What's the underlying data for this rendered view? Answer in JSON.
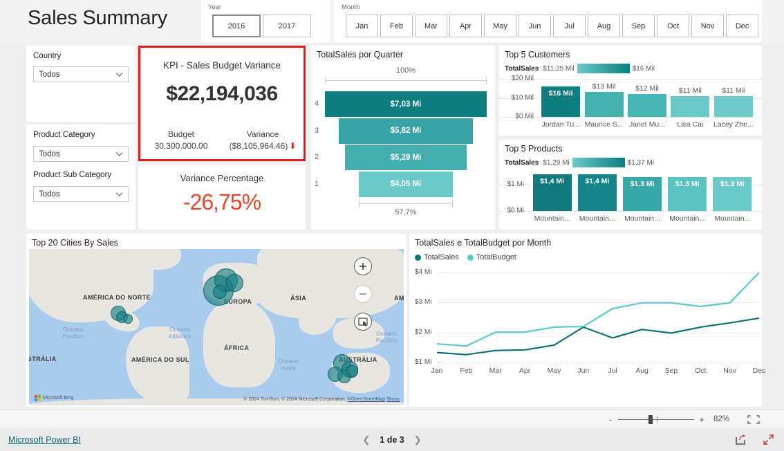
{
  "report": {
    "title": "Sales Summary"
  },
  "year_slicer": {
    "label": "Year",
    "options": [
      "2016",
      "2017"
    ],
    "selected": "2016"
  },
  "month_slicer": {
    "label": "Month",
    "options": [
      "Jan",
      "Feb",
      "Mar",
      "Apr",
      "May",
      "Jun",
      "Jul",
      "Aug",
      "Sep",
      "Oct",
      "Nov",
      "Dec"
    ]
  },
  "filters": [
    {
      "label": "Country",
      "value": "Todos",
      "icon": "chevron-down-icon"
    },
    {
      "label": "Product Category",
      "value": "Todos",
      "icon": "chevron-down-icon"
    },
    {
      "label": "Product Sub Category",
      "value": "Todos",
      "icon": "chevron-down-icon"
    }
  ],
  "kpi": {
    "title": "KPI - Sales Budget Variance",
    "value": "$22,194,036",
    "budget_caption": "Budget",
    "budget_value": "30,300,000.00",
    "variance_caption": "Variance",
    "variance_value": "($8,105,964.46)",
    "trend_icon": "down-arrow-icon",
    "border_color": "#e01b1b"
  },
  "variance_percentage": {
    "title": "Variance Percentage",
    "value": "-26,75%",
    "color": "#e8472a"
  },
  "map": {
    "title": "Top 20 Cities By Sales",
    "attribution": "© 2024 TomTom, © 2024 Microsoft Corporation,",
    "attribution_osm": "©OpenStreetMap",
    "attribution_terms": "Terms",
    "provider": "Microsoft Bing",
    "continents": [
      "AMÉRICA DO NORTE",
      "EUROPA",
      "ÁSIA",
      "ÁFRICA",
      "AMÉRICA DO SUL",
      "AUSTRÁLIA",
      "AUSTRÁLIA",
      "AM"
    ],
    "oceans": [
      "Oceano Pacífico",
      "Oceano Atlântico",
      "Oceano Pacífico",
      "Oceano Índico"
    ],
    "controls": [
      "zoom-in-icon",
      "zoom-out-icon",
      "select-tool-icon"
    ]
  },
  "statusbar": {
    "zoom_out_label": "-",
    "zoom_in_label": "+",
    "zoom_value": "82%",
    "fit_icon": "fit-to-page-icon"
  },
  "footer": {
    "brand": "Microsoft Power BI",
    "page_text": "1 de 3",
    "prev_icon": "chevron-left-icon",
    "next_icon": "chevron-right-icon",
    "share_icon": "share-icon",
    "fullscreen_icon": "fullscreen-icon"
  },
  "chart_data": [
    {
      "id": "funnel",
      "type": "bar",
      "title": "TotalSales por Quarter",
      "categories": [
        "4",
        "3",
        "2",
        "1"
      ],
      "values": [
        7.03,
        5.82,
        5.29,
        4.05
      ],
      "labels": [
        "$7,03 Mi",
        "$5,82 Mi",
        "$5,29 Mi",
        "$4,05 Mi"
      ],
      "top_measure": "100%",
      "bottom_measure": "57,7%",
      "percentages": [
        100,
        82.8,
        75.2,
        57.7
      ],
      "colors": [
        "#0d7d80",
        "#37a3a5",
        "#45afb0",
        "#6bc9c9"
      ],
      "xlabel": "",
      "ylabel": "",
      "grid": false
    },
    {
      "id": "top-customers",
      "type": "bar",
      "title": "Top 5 Customers",
      "legend_measure": "TotalSales",
      "legend_min": "$11,25 Mil",
      "legend_max": "$16 Mil",
      "categories": [
        "Jordan Tu...",
        "Maurice S...",
        "Janet Mu...",
        "Lisa Cai",
        "Lacey Zhe..."
      ],
      "values": [
        16,
        13,
        12,
        11,
        11
      ],
      "labels": [
        "$16 Mil",
        "$13 Mil",
        "$12 Mil",
        "$11 Mil",
        "$11 Mil"
      ],
      "colors": [
        "#0d7d80",
        "#47b0b0",
        "#4ab3b3",
        "#6bc9c9",
        "#6fcbcb"
      ],
      "yticks": [
        "$20 Mil",
        "$10 Mil",
        "$0 Mil"
      ],
      "ylim": [
        0,
        20
      ],
      "ylabel": "",
      "xlabel": "",
      "grid": true
    },
    {
      "id": "top-products",
      "type": "bar",
      "title": "Top 5 Products",
      "legend_measure": "TotalSales",
      "legend_min": "$1,29 Mi",
      "legend_max": "$1,37 Mi",
      "categories": [
        "Mountain...",
        "Mountain...",
        "Mountain...",
        "Mountain...",
        "Mountain..."
      ],
      "values": [
        1.4,
        1.4,
        1.3,
        1.3,
        1.3
      ],
      "labels": [
        "$1,4 Mi",
        "$1,4 Mi",
        "$1,3 Mi",
        "$1,3 Mi",
        "$1,3 Mi"
      ],
      "colors": [
        "#11787b",
        "#15858a",
        "#37a8a8",
        "#5bc2c2",
        "#6bc9c9"
      ],
      "yticks": [
        "$1 Mi",
        "$0 Mi"
      ],
      "ylim": [
        0,
        1.45
      ],
      "ylabel": "",
      "xlabel": "",
      "grid": true
    },
    {
      "id": "sales-budget-by-month",
      "type": "line",
      "title": "TotalSales e TotalBudget por Month",
      "x": [
        "Jan",
        "Feb",
        "Mar",
        "Apr",
        "May",
        "Jun",
        "Jul",
        "Aug",
        "Sep",
        "Oct",
        "Nov",
        "Dec"
      ],
      "series": [
        {
          "name": "TotalSales",
          "color": "#0d7174",
          "values": [
            1.33,
            1.26,
            1.4,
            1.42,
            1.58,
            2.18,
            1.82,
            2.1,
            1.98,
            2.18,
            2.32,
            2.48
          ]
        },
        {
          "name": "TotalBudget",
          "color": "#5bc9c9",
          "values": [
            1.62,
            1.55,
            2.01,
            2.01,
            2.18,
            2.2,
            2.8,
            2.99,
            2.99,
            2.87,
            2.99,
            4.0
          ]
        }
      ],
      "yticks": [
        "$4 Mi",
        "$3 Mi",
        "$2 Mi",
        "$1 Mi"
      ],
      "ylim": [
        1,
        4
      ],
      "ylabel": "",
      "xlabel": "",
      "grid": true,
      "legend_position": "top-left"
    }
  ]
}
